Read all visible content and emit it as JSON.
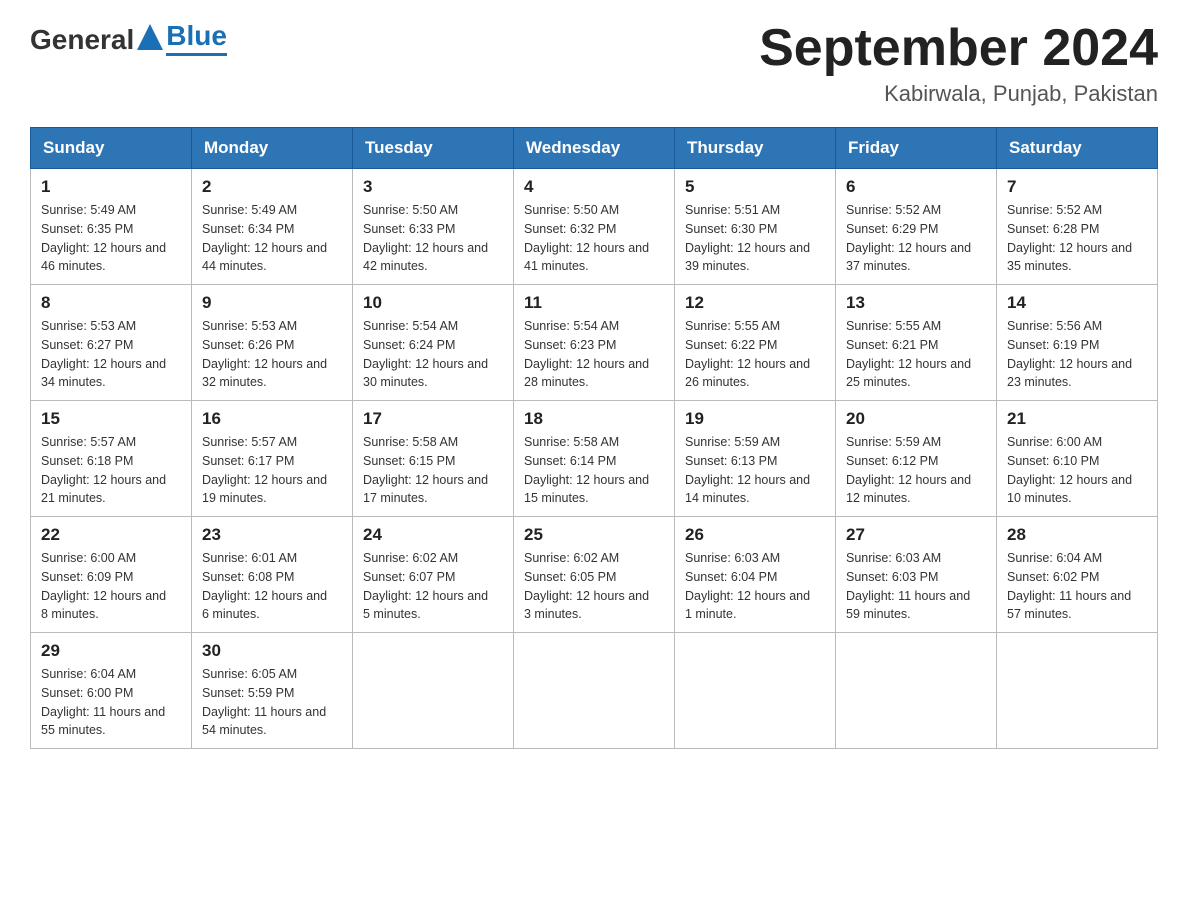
{
  "header": {
    "logo": {
      "general": "General",
      "blue": "Blue"
    },
    "title": "September 2024",
    "subtitle": "Kabirwala, Punjab, Pakistan"
  },
  "calendar": {
    "days_of_week": [
      "Sunday",
      "Monday",
      "Tuesday",
      "Wednesday",
      "Thursday",
      "Friday",
      "Saturday"
    ],
    "weeks": [
      [
        {
          "day": "1",
          "sunrise": "Sunrise: 5:49 AM",
          "sunset": "Sunset: 6:35 PM",
          "daylight": "Daylight: 12 hours and 46 minutes."
        },
        {
          "day": "2",
          "sunrise": "Sunrise: 5:49 AM",
          "sunset": "Sunset: 6:34 PM",
          "daylight": "Daylight: 12 hours and 44 minutes."
        },
        {
          "day": "3",
          "sunrise": "Sunrise: 5:50 AM",
          "sunset": "Sunset: 6:33 PM",
          "daylight": "Daylight: 12 hours and 42 minutes."
        },
        {
          "day": "4",
          "sunrise": "Sunrise: 5:50 AM",
          "sunset": "Sunset: 6:32 PM",
          "daylight": "Daylight: 12 hours and 41 minutes."
        },
        {
          "day": "5",
          "sunrise": "Sunrise: 5:51 AM",
          "sunset": "Sunset: 6:30 PM",
          "daylight": "Daylight: 12 hours and 39 minutes."
        },
        {
          "day": "6",
          "sunrise": "Sunrise: 5:52 AM",
          "sunset": "Sunset: 6:29 PM",
          "daylight": "Daylight: 12 hours and 37 minutes."
        },
        {
          "day": "7",
          "sunrise": "Sunrise: 5:52 AM",
          "sunset": "Sunset: 6:28 PM",
          "daylight": "Daylight: 12 hours and 35 minutes."
        }
      ],
      [
        {
          "day": "8",
          "sunrise": "Sunrise: 5:53 AM",
          "sunset": "Sunset: 6:27 PM",
          "daylight": "Daylight: 12 hours and 34 minutes."
        },
        {
          "day": "9",
          "sunrise": "Sunrise: 5:53 AM",
          "sunset": "Sunset: 6:26 PM",
          "daylight": "Daylight: 12 hours and 32 minutes."
        },
        {
          "day": "10",
          "sunrise": "Sunrise: 5:54 AM",
          "sunset": "Sunset: 6:24 PM",
          "daylight": "Daylight: 12 hours and 30 minutes."
        },
        {
          "day": "11",
          "sunrise": "Sunrise: 5:54 AM",
          "sunset": "Sunset: 6:23 PM",
          "daylight": "Daylight: 12 hours and 28 minutes."
        },
        {
          "day": "12",
          "sunrise": "Sunrise: 5:55 AM",
          "sunset": "Sunset: 6:22 PM",
          "daylight": "Daylight: 12 hours and 26 minutes."
        },
        {
          "day": "13",
          "sunrise": "Sunrise: 5:55 AM",
          "sunset": "Sunset: 6:21 PM",
          "daylight": "Daylight: 12 hours and 25 minutes."
        },
        {
          "day": "14",
          "sunrise": "Sunrise: 5:56 AM",
          "sunset": "Sunset: 6:19 PM",
          "daylight": "Daylight: 12 hours and 23 minutes."
        }
      ],
      [
        {
          "day": "15",
          "sunrise": "Sunrise: 5:57 AM",
          "sunset": "Sunset: 6:18 PM",
          "daylight": "Daylight: 12 hours and 21 minutes."
        },
        {
          "day": "16",
          "sunrise": "Sunrise: 5:57 AM",
          "sunset": "Sunset: 6:17 PM",
          "daylight": "Daylight: 12 hours and 19 minutes."
        },
        {
          "day": "17",
          "sunrise": "Sunrise: 5:58 AM",
          "sunset": "Sunset: 6:15 PM",
          "daylight": "Daylight: 12 hours and 17 minutes."
        },
        {
          "day": "18",
          "sunrise": "Sunrise: 5:58 AM",
          "sunset": "Sunset: 6:14 PM",
          "daylight": "Daylight: 12 hours and 15 minutes."
        },
        {
          "day": "19",
          "sunrise": "Sunrise: 5:59 AM",
          "sunset": "Sunset: 6:13 PM",
          "daylight": "Daylight: 12 hours and 14 minutes."
        },
        {
          "day": "20",
          "sunrise": "Sunrise: 5:59 AM",
          "sunset": "Sunset: 6:12 PM",
          "daylight": "Daylight: 12 hours and 12 minutes."
        },
        {
          "day": "21",
          "sunrise": "Sunrise: 6:00 AM",
          "sunset": "Sunset: 6:10 PM",
          "daylight": "Daylight: 12 hours and 10 minutes."
        }
      ],
      [
        {
          "day": "22",
          "sunrise": "Sunrise: 6:00 AM",
          "sunset": "Sunset: 6:09 PM",
          "daylight": "Daylight: 12 hours and 8 minutes."
        },
        {
          "day": "23",
          "sunrise": "Sunrise: 6:01 AM",
          "sunset": "Sunset: 6:08 PM",
          "daylight": "Daylight: 12 hours and 6 minutes."
        },
        {
          "day": "24",
          "sunrise": "Sunrise: 6:02 AM",
          "sunset": "Sunset: 6:07 PM",
          "daylight": "Daylight: 12 hours and 5 minutes."
        },
        {
          "day": "25",
          "sunrise": "Sunrise: 6:02 AM",
          "sunset": "Sunset: 6:05 PM",
          "daylight": "Daylight: 12 hours and 3 minutes."
        },
        {
          "day": "26",
          "sunrise": "Sunrise: 6:03 AM",
          "sunset": "Sunset: 6:04 PM",
          "daylight": "Daylight: 12 hours and 1 minute."
        },
        {
          "day": "27",
          "sunrise": "Sunrise: 6:03 AM",
          "sunset": "Sunset: 6:03 PM",
          "daylight": "Daylight: 11 hours and 59 minutes."
        },
        {
          "day": "28",
          "sunrise": "Sunrise: 6:04 AM",
          "sunset": "Sunset: 6:02 PM",
          "daylight": "Daylight: 11 hours and 57 minutes."
        }
      ],
      [
        {
          "day": "29",
          "sunrise": "Sunrise: 6:04 AM",
          "sunset": "Sunset: 6:00 PM",
          "daylight": "Daylight: 11 hours and 55 minutes."
        },
        {
          "day": "30",
          "sunrise": "Sunrise: 6:05 AM",
          "sunset": "Sunset: 5:59 PM",
          "daylight": "Daylight: 11 hours and 54 minutes."
        },
        null,
        null,
        null,
        null,
        null
      ]
    ]
  }
}
